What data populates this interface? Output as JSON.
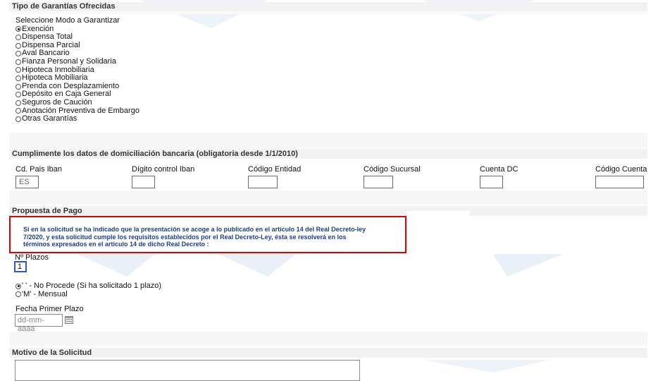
{
  "garantias": {
    "title": "Tipo de Garantías Ofrecidas",
    "prompt": "Seleccione Modo a Garantizar",
    "options": [
      {
        "label": "Exención",
        "checked": true
      },
      {
        "label": "Dispensa Total",
        "checked": false
      },
      {
        "label": "Dispensa Parcial",
        "checked": false
      },
      {
        "label": "Aval Bancario",
        "checked": false
      },
      {
        "label": "Fianza Personal y Solidaria",
        "checked": false
      },
      {
        "label": "Hipoteca Inmobiliaria",
        "checked": false
      },
      {
        "label": "Hipoteca Mobiliaria",
        "checked": false
      },
      {
        "label": "Prenda con Desplazamiento",
        "checked": false
      },
      {
        "label": "Depósito en Caja General",
        "checked": false
      },
      {
        "label": "Seguros de Caución",
        "checked": false
      },
      {
        "label": "Anotación Preventiva de Embargo",
        "checked": false
      },
      {
        "label": "Otras Garantías",
        "checked": false
      }
    ]
  },
  "bancaria": {
    "title": "Cumplimente los datos de domiciliación bancaria (obligatoria desde 1/1/2010)",
    "fields": [
      {
        "label": "Cd. Pais Iban",
        "value": "ES"
      },
      {
        "label": "Dígito control Iban",
        "value": ""
      },
      {
        "label": "Código Entidad",
        "value": ""
      },
      {
        "label": "Código Sucursal",
        "value": ""
      },
      {
        "label": "Cuenta DC",
        "value": ""
      },
      {
        "label": "Código Cuenta",
        "value": ""
      }
    ]
  },
  "pago": {
    "title": "Propuesta de Pago",
    "notice_lines": [
      "Si en la solicitud se ha indicado que la presentación se acoge a lo publicado en el artículo 14 del Real Decreto-ley",
      "7/2020, y esta solicitud cumple los requisitos establecidos por el Real Decreto-Ley, ésta se resolverá en los",
      "términos expresados en el artículo 14 de dicho Real Decreto :"
    ],
    "plazos_label": "Nº Plazos",
    "plazos_value": "1",
    "periodicidad": [
      {
        "label": "' ' - No Procede (Si ha solicitado 1 plazo)",
        "checked": true
      },
      {
        "label": "'M' - Mensual",
        "checked": false
      }
    ],
    "fecha_label": "Fecha Primer Plazo",
    "fecha_placeholder": "dd-mm-aaaa"
  },
  "motivo": {
    "title": "Motivo de la Solicitud"
  },
  "colors": {
    "notice_border": "#e00000",
    "notice_text": "#1a3f8f",
    "section_bg": "#f2f2f2",
    "focus_border": "#2a5db0"
  }
}
